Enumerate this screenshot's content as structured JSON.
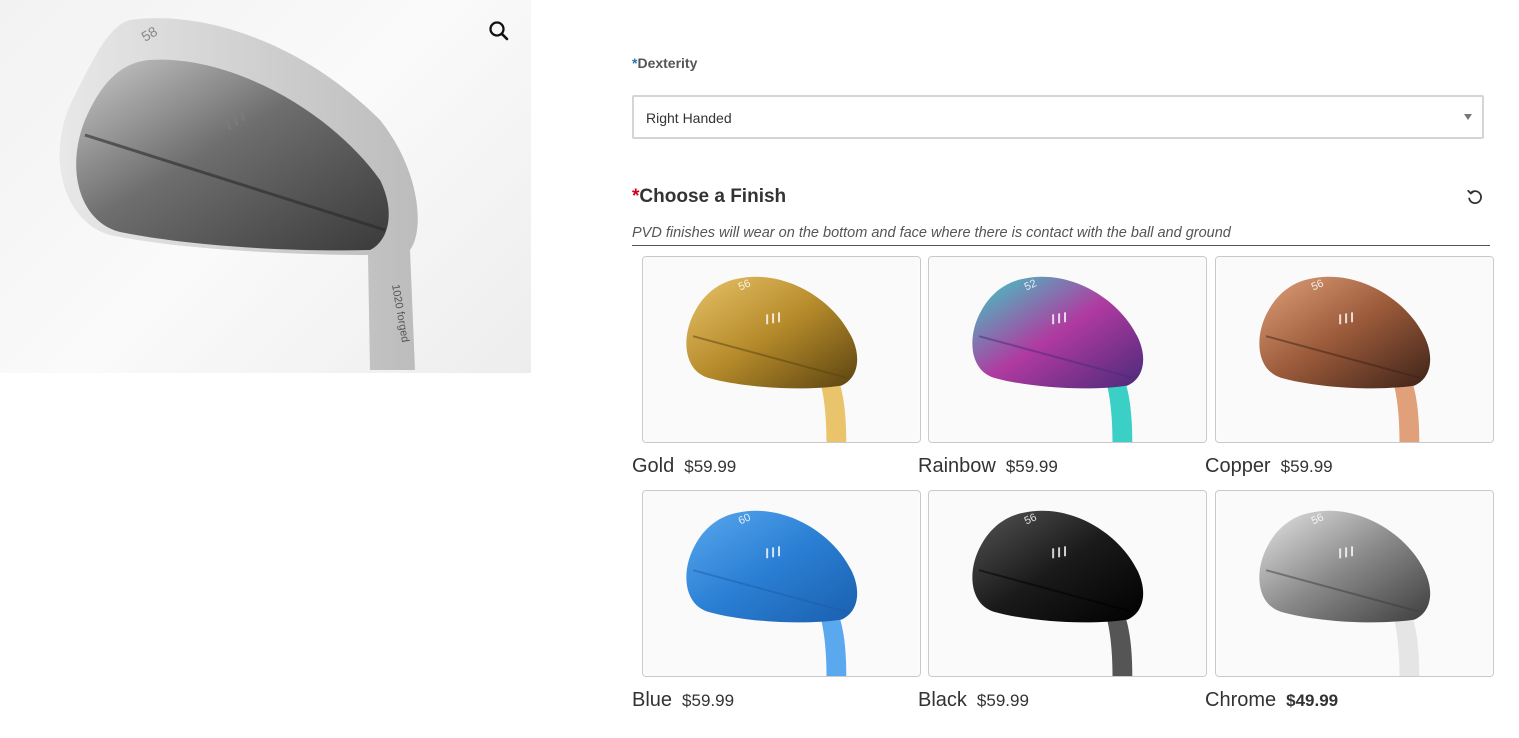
{
  "product_image": {
    "alt": "Chrome wedge",
    "club_text": "1020 forged",
    "loft": "58"
  },
  "dexterity": {
    "required_mark": "*",
    "label": "Dexterity",
    "selected": "Right Handed"
  },
  "finish": {
    "required_mark": "*",
    "label": "Choose a Finish",
    "note": "PVD finishes will wear on the bottom and face where there is contact with the ball and ground",
    "options": [
      {
        "name": "Gold",
        "price": "$59.99",
        "loft": "56",
        "color": "#b58a2a",
        "light": "#e9c46a",
        "dark": "#5a4311"
      },
      {
        "name": "Rainbow",
        "price": "$59.99",
        "loft": "52",
        "color": "#b03aa0",
        "light": "#3ad0c6",
        "dark": "#4a2a7a"
      },
      {
        "name": "Copper",
        "price": "$59.99",
        "loft": "56",
        "color": "#9a5a3a",
        "light": "#e0a07a",
        "dark": "#3d2218"
      },
      {
        "name": "Blue",
        "price": "$59.99",
        "loft": "60",
        "color": "#2a7fd4",
        "light": "#5aa8ee",
        "dark": "#1b5fae"
      },
      {
        "name": "Black",
        "price": "$59.99",
        "loft": "56",
        "color": "#1a1a1a",
        "light": "#555555",
        "dark": "#000000"
      },
      {
        "name": "Chrome",
        "price": "$49.99",
        "loft": "56",
        "color": "#8a8a8a",
        "light": "#e5e5e5",
        "dark": "#3d3d3d"
      }
    ]
  },
  "icons": {
    "zoom": "magnifier-icon",
    "reset": "reset-icon",
    "select_arrow": "chevron-down-icon"
  }
}
